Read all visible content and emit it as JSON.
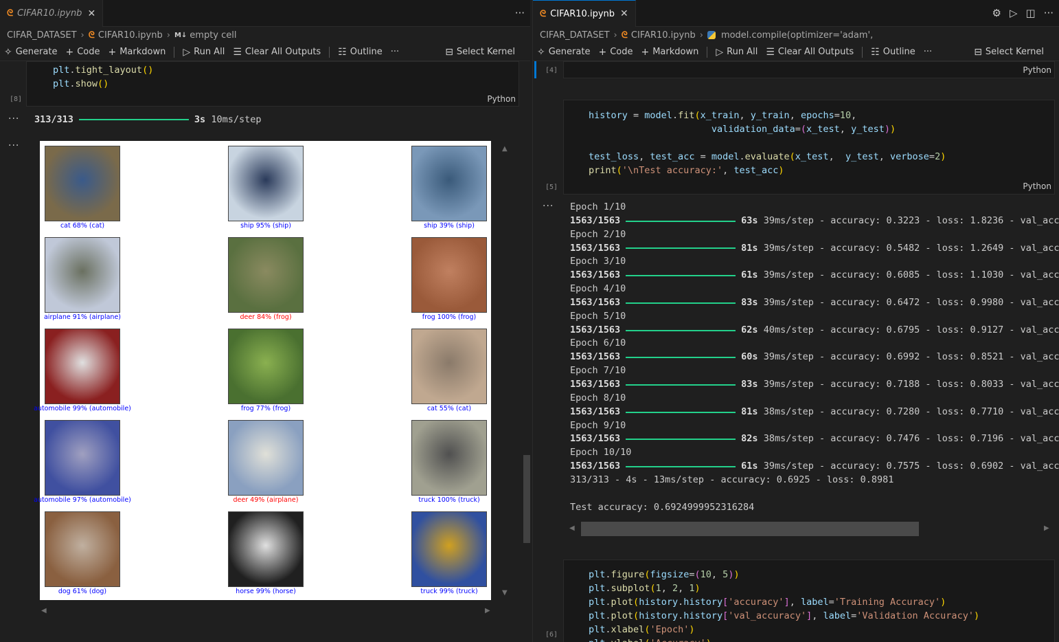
{
  "left": {
    "tab": {
      "title": "CIFAR10.ipynb"
    },
    "breadcrumb": [
      "CIFAR_DATASET",
      "CIFAR10.ipynb",
      "empty cell"
    ],
    "toolbar": {
      "generate": "Generate",
      "code": "Code",
      "markdown": "Markdown",
      "run_all": "Run All",
      "clear": "Clear All Outputs",
      "outline": "Outline",
      "kernel": "Select Kernel"
    },
    "cell8": {
      "lines": [
        "plt.tight_layout()",
        "plt.show()"
      ],
      "num": "[8]",
      "lang": "Python"
    },
    "progress": {
      "count": "313/313",
      "time": "3s",
      "rate": "10ms/step"
    },
    "images": [
      {
        "caption": "cat 68% (cat)",
        "correct": true
      },
      {
        "caption": "ship 95% (ship)",
        "correct": true
      },
      {
        "caption": "ship 39% (ship)",
        "correct": true
      },
      {
        "caption": "airplane 91% (airplane)",
        "correct": true
      },
      {
        "caption": "deer 84% (frog)",
        "correct": false
      },
      {
        "caption": "frog 100% (frog)",
        "correct": true
      },
      {
        "caption": "automobile 99% (automobile)",
        "correct": true
      },
      {
        "caption": "frog 77% (frog)",
        "correct": true
      },
      {
        "caption": "cat 55% (cat)",
        "correct": true
      },
      {
        "caption": "automobile 97% (automobile)",
        "correct": true
      },
      {
        "caption": "deer 49% (airplane)",
        "correct": false
      },
      {
        "caption": "truck 100% (truck)",
        "correct": true
      },
      {
        "caption": "dog 61% (dog)",
        "correct": true
      },
      {
        "caption": "horse 99% (horse)",
        "correct": true
      },
      {
        "caption": "truck 99% (truck)",
        "correct": true
      }
    ],
    "colors": {
      "correct": "#0000ff",
      "wrong": "#ff0000"
    }
  },
  "right": {
    "tab": {
      "title": "CIFAR10.ipynb"
    },
    "breadcrumb": [
      "CIFAR_DATASET",
      "CIFAR10.ipynb",
      "model.compile(optimizer='adam',"
    ],
    "toolbar": {
      "generate": "Generate",
      "code": "Code",
      "markdown": "Markdown",
      "run_all": "Run All",
      "clear": "Clear All Outputs",
      "outline": "Outline",
      "kernel": "Select Kernel"
    },
    "cell4": {
      "num": "[4]",
      "lang": "Python"
    },
    "cell5": {
      "num": "[5]",
      "lang": "Python"
    },
    "cell6": {
      "num": "[6]"
    },
    "epochs": [
      {
        "label": "Epoch 1/10",
        "time": "63s",
        "rate": "39ms/step",
        "acc": "0.3223",
        "loss": "1.8236"
      },
      {
        "label": "Epoch 2/10",
        "time": "81s",
        "rate": "39ms/step",
        "acc": "0.5482",
        "loss": "1.2649"
      },
      {
        "label": "Epoch 3/10",
        "time": "61s",
        "rate": "39ms/step",
        "acc": "0.6085",
        "loss": "1.1030"
      },
      {
        "label": "Epoch 4/10",
        "time": "83s",
        "rate": "39ms/step",
        "acc": "0.6472",
        "loss": "0.9980"
      },
      {
        "label": "Epoch 5/10",
        "time": "62s",
        "rate": "40ms/step",
        "acc": "0.6795",
        "loss": "0.9127"
      },
      {
        "label": "Epoch 6/10",
        "time": "60s",
        "rate": "39ms/step",
        "acc": "0.6992",
        "loss": "0.8521"
      },
      {
        "label": "Epoch 7/10",
        "time": "83s",
        "rate": "39ms/step",
        "acc": "0.7188",
        "loss": "0.8033"
      },
      {
        "label": "Epoch 8/10",
        "time": "81s",
        "rate": "38ms/step",
        "acc": "0.7280",
        "loss": "0.7710"
      },
      {
        "label": "Epoch 9/10",
        "time": "82s",
        "rate": "38ms/step",
        "acc": "0.7476",
        "loss": "0.7196"
      },
      {
        "label": "Epoch 10/10",
        "time": "61s",
        "rate": "39ms/step",
        "acc": "0.7575",
        "loss": "0.6902"
      }
    ],
    "steps": "1563/1563",
    "eval_line": "313/313 - 4s - 13ms/step - accuracy: 0.6925 - loss: 0.8981",
    "test_line": "Test accuracy: 0.6924999952316284"
  }
}
